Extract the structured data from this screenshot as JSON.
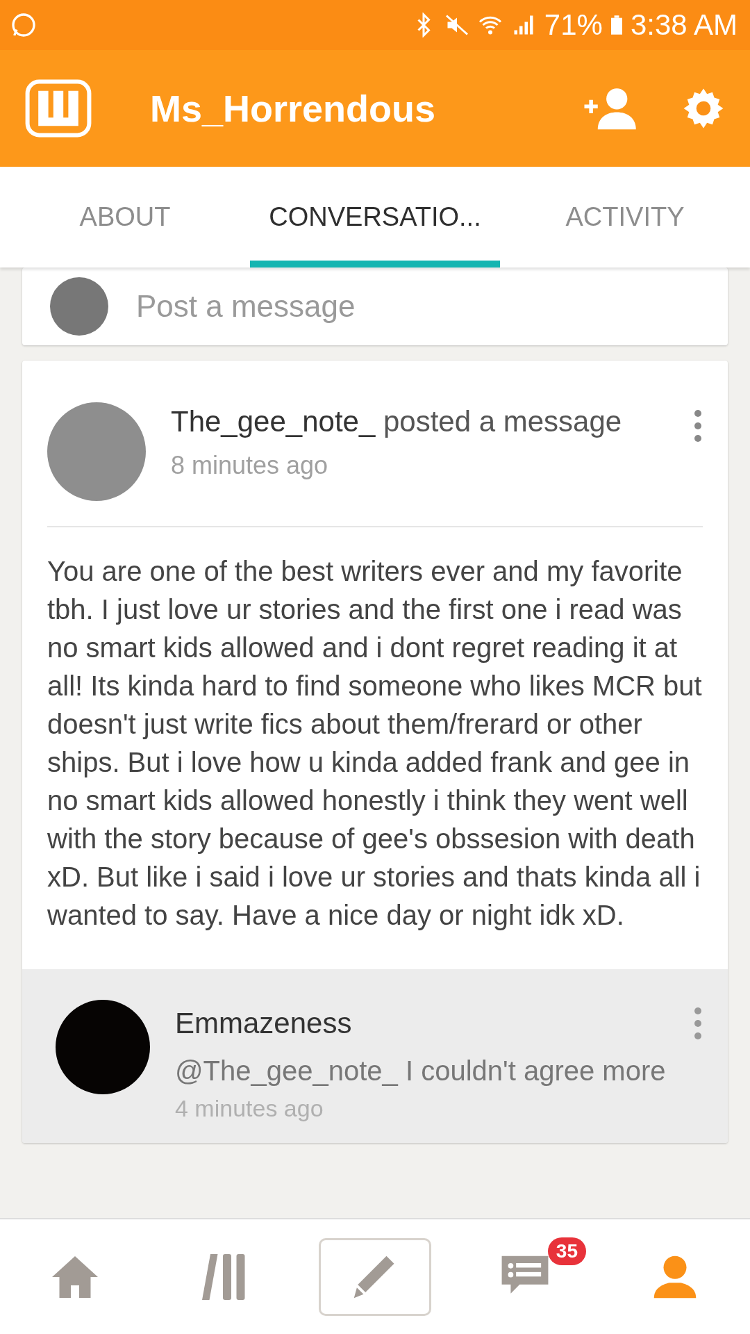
{
  "status_bar": {
    "battery": "71%",
    "time": "3:38 AM"
  },
  "app_bar": {
    "title": "Ms_Horrendous"
  },
  "tabs": [
    {
      "label": "ABOUT",
      "selected": false
    },
    {
      "label": "CONVERSATIO...",
      "selected": true
    },
    {
      "label": "ACTIVITY",
      "selected": false
    }
  ],
  "composer": {
    "placeholder": "Post a message"
  },
  "post": {
    "author": "The_gee_note_",
    "action": "posted a message",
    "time": "8 minutes ago",
    "body": "You are one of the best writers ever and my favorite tbh. I just love ur stories and the first one i read was no smart kids allowed and i dont regret reading it at all! Its kinda hard to find someone who likes MCR but doesn't just write fics about them/frerard or other ships. But i love how u kinda added frank and gee in no smart kids allowed honestly i think they went well with the story because of gee's obssesion with death xD. But like i said i love ur stories and thats kinda all i wanted to say. Have a nice day or night idk xD.",
    "replies": [
      {
        "author": "Emmazeness",
        "text": "@The_gee_note_ I couldn't agree more",
        "time": "4 minutes ago"
      }
    ]
  },
  "bottom_nav": [
    {
      "kind": "home",
      "selected": false
    },
    {
      "kind": "library",
      "selected": false
    },
    {
      "kind": "write",
      "selected": false
    },
    {
      "kind": "messages",
      "selected": false,
      "badge": "35"
    },
    {
      "kind": "profile",
      "selected": true
    }
  ]
}
